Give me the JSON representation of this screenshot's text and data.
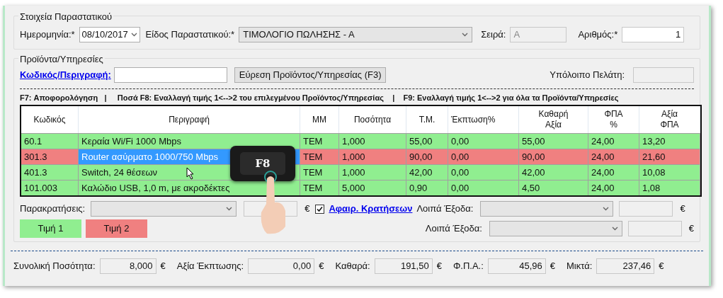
{
  "document_group": {
    "title": "Στοιχεία Παραστατικού",
    "date_label": "Ημερομηνία:*",
    "date_value": "08/10/2017",
    "type_label": "Είδος Παραστατικού:*",
    "type_value": "ΤΙΜΟΛΟΓΙΟ ΠΩΛΗΣΗΣ - Α",
    "series_label": "Σειρά:",
    "series_value": "Α",
    "number_label": "Αριθμός:*",
    "number_value": "1"
  },
  "products_group": {
    "title": "Προϊόντα/Υπηρεσίες",
    "code_link": "Κωδικός/Περιγραφή:",
    "search_button": "Εύρεση Προϊόντος/Υπηρεσίας (F3)",
    "balance_label": "Υπόλοιπο Πελάτη:"
  },
  "shortcuts": "F7: Αποφορολόγηση   |     Ποσά F8: Εναλλαγή τιμής 1<-->2 του επιλεγμένου Προϊόντος/Υπηρεσίας    |    F9: Εναλλαγή τιμής 1<-->2 για όλα τα Προϊόντα/Υπηρεσίες",
  "table": {
    "columns": [
      "Κωδικός",
      "Περιγραφή",
      "ΜΜ",
      "Ποσότητα",
      "Τ.Μ.",
      "Έκπτωση%",
      "Καθαρή\nΑξία",
      "ΦΠΑ\n%",
      "Αξία\nΦΠΑ"
    ],
    "rows": [
      {
        "color": "#90ee90",
        "selected": false,
        "cells": [
          "60.1",
          "Κεραία Wi/Fi 1000 Mbps",
          "TEM",
          "1,000",
          "55,00",
          "0,00",
          "55,00",
          "24,00",
          "13,20"
        ]
      },
      {
        "color": "#f08080",
        "selected": true,
        "cells": [
          "301.3",
          "Router ασύρματο 1000/750 Mbps",
          "TEM",
          "1,000",
          "90,00",
          "0,00",
          "90,00",
          "24,00",
          "21,60"
        ]
      },
      {
        "color": "#90ee90",
        "selected": false,
        "cells": [
          "401.3",
          "Switch, 24 θέσεων",
          "TEM",
          "1,000",
          "42,00",
          "0,00",
          "42,00",
          "24,00",
          "10,08"
        ]
      },
      {
        "color": "#90ee90",
        "selected": false,
        "cells": [
          "101.003",
          "Καλώδιο USB, 1,0 m, με ακροδέκτες",
          "TEM",
          "5,000",
          "0,90",
          "0,00",
          "4,50",
          "24,00",
          "1,08"
        ]
      }
    ]
  },
  "key_overlay": {
    "key": "F8"
  },
  "withholdings": {
    "label": "Παρακρατήσεις:",
    "currency": "€",
    "deduct_checked": true,
    "deduct_link": "Αφαιρ. Κρατήσεων"
  },
  "other_expenses": [
    {
      "label": "Λοιπά Έξοδα:",
      "currency": "€"
    },
    {
      "label": "Λοιπά Έξοδα:",
      "currency": "€"
    }
  ],
  "legend": [
    {
      "label": "Τιμή 1",
      "color": "#90ee90"
    },
    {
      "label": "Τιμή 2",
      "color": "#f08080"
    }
  ],
  "totals": [
    {
      "label": "Συνολική Ποσότητα:",
      "value": "8,000",
      "currency": "€"
    },
    {
      "label": "Αξία Έκπτωσης:",
      "value": "0,00",
      "currency": "€"
    },
    {
      "label": "Καθαρά:",
      "value": "191,50",
      "currency": "€"
    },
    {
      "label": "Φ.Π.Α.:",
      "value": "45,96",
      "currency": "€"
    },
    {
      "label": "Μικτά:",
      "value": "237,46",
      "currency": "€"
    }
  ]
}
